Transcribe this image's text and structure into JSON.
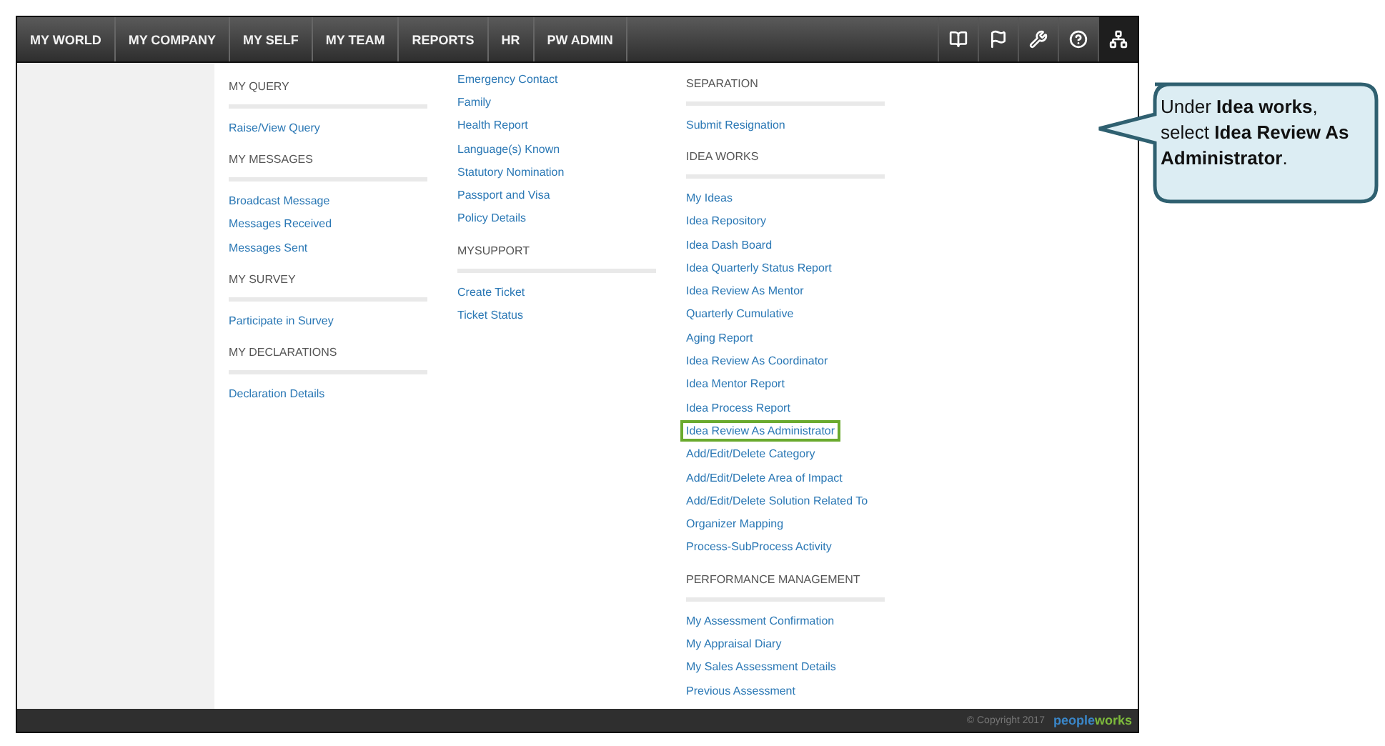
{
  "nav": {
    "items": [
      {
        "label": "MY WORLD"
      },
      {
        "label": "MY COMPANY"
      },
      {
        "label": "MY SELF"
      },
      {
        "label": "MY TEAM"
      },
      {
        "label": "REPORTS"
      },
      {
        "label": "HR"
      },
      {
        "label": "PW ADMIN"
      }
    ]
  },
  "columns": [
    {
      "sections": [
        {
          "heading": "MY QUERY",
          "links": [
            {
              "label": "Raise/View Query",
              "highlighted": false
            }
          ]
        },
        {
          "heading": "MY MESSAGES",
          "links": [
            {
              "label": "Broadcast Message",
              "highlighted": false
            },
            {
              "label": "Messages Received",
              "highlighted": false
            },
            {
              "label": "Messages Sent",
              "highlighted": false
            }
          ]
        },
        {
          "heading": "MY SURVEY",
          "links": [
            {
              "label": "Participate in Survey",
              "highlighted": false
            }
          ]
        },
        {
          "heading": "MY DECLARATIONS",
          "links": [
            {
              "label": "Declaration Details",
              "highlighted": false
            }
          ]
        }
      ]
    },
    {
      "sections": [
        {
          "links": [
            {
              "label": "Emergency Contact",
              "highlighted": false
            },
            {
              "label": "Family",
              "highlighted": false
            },
            {
              "label": "Health Report",
              "highlighted": false
            },
            {
              "label": "Language(s) Known",
              "highlighted": false
            },
            {
              "label": "Statutory Nomination",
              "highlighted": false
            },
            {
              "label": "Passport and Visa",
              "highlighted": false
            },
            {
              "label": "Policy Details",
              "highlighted": false
            }
          ]
        },
        {
          "heading": "MYSUPPORT",
          "links": [
            {
              "label": "Create Ticket",
              "highlighted": false
            },
            {
              "label": "Ticket Status",
              "highlighted": false
            }
          ]
        }
      ]
    },
    {
      "sections": [
        {
          "heading": "SEPARATION",
          "links": [
            {
              "label": "Submit Resignation",
              "highlighted": false
            }
          ]
        },
        {
          "heading": "IDEA WORKS",
          "links": [
            {
              "label": "My Ideas",
              "highlighted": false
            },
            {
              "label": "Idea Repository",
              "highlighted": false
            },
            {
              "label": "Idea Dash Board",
              "highlighted": false
            },
            {
              "label": "Idea Quarterly Status Report",
              "highlighted": false
            },
            {
              "label": "Idea Review As Mentor",
              "highlighted": false
            },
            {
              "label": "Quarterly Cumulative",
              "highlighted": false
            },
            {
              "label": "Aging Report",
              "highlighted": false
            },
            {
              "label": "Idea Review As Coordinator",
              "highlighted": false
            },
            {
              "label": "Idea Mentor Report",
              "highlighted": false
            },
            {
              "label": "Idea Process Report",
              "highlighted": false
            },
            {
              "label": "Idea Review As Administrator",
              "highlighted": true
            },
            {
              "label": "Add/Edit/Delete Category",
              "highlighted": false
            },
            {
              "label": "Add/Edit/Delete Area of Impact",
              "highlighted": false
            },
            {
              "label": "Add/Edit/Delete Solution Related To",
              "highlighted": false
            },
            {
              "label": "Organizer Mapping",
              "highlighted": false
            },
            {
              "label": "Process-SubProcess Activity",
              "highlighted": false
            }
          ]
        },
        {
          "heading": "PERFORMANCE MANAGEMENT",
          "links": [
            {
              "label": "My Assessment Confirmation",
              "highlighted": false
            },
            {
              "label": "My Appraisal Diary",
              "highlighted": false
            },
            {
              "label": "My Sales Assessment Details",
              "highlighted": false
            },
            {
              "label": "Previous Assessment",
              "highlighted": false
            }
          ]
        }
      ]
    }
  ],
  "footer": {
    "copyright": "© Copyright 2017",
    "logo_parts": [
      "people",
      "works"
    ]
  },
  "callout": {
    "text": "Under **Idea works**, select **Idea Review As Administrator**."
  }
}
